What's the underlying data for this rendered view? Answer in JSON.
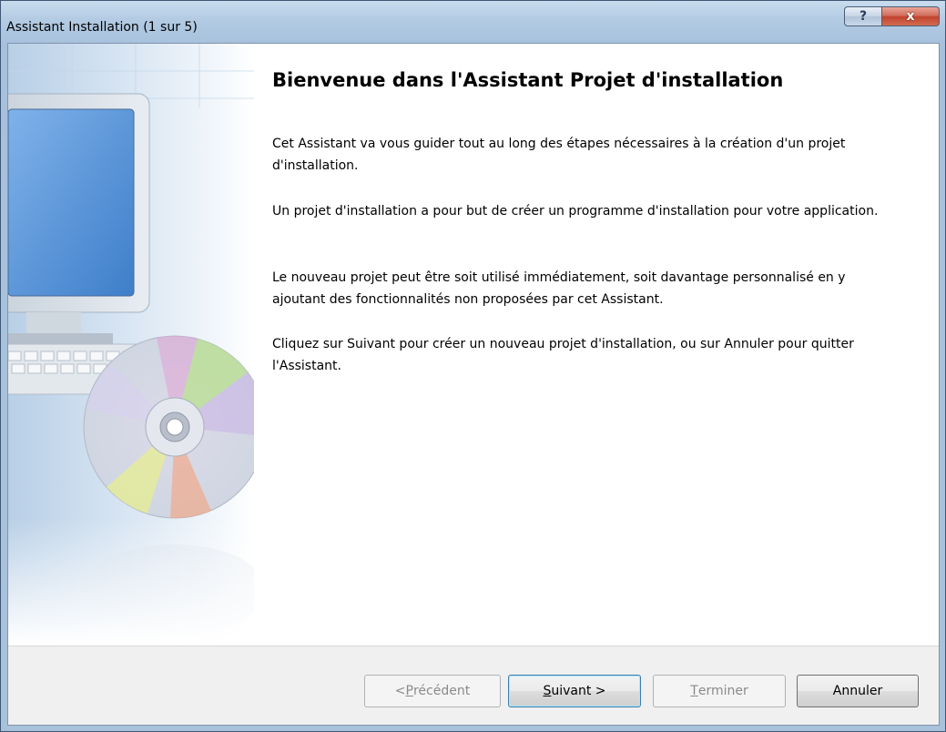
{
  "window": {
    "title": "Assistant Installation (1 sur 5)",
    "help_label": "?",
    "close_label": "x"
  },
  "content": {
    "heading": "Bienvenue dans l'Assistant Projet d'installation",
    "paragraphs": [
      "Cet Assistant va vous guider tout au long des étapes nécessaires à la création d'un projet d'installation.",
      "Un projet d'installation a pour but de créer un programme d'installation pour votre application.",
      "Le nouveau projet peut être soit utilisé immédiatement, soit davantage personnalisé en y ajoutant des fonctionnalités non proposées par cet Assistant.",
      "Cliquez sur Suivant pour créer un nouveau projet d'installation, ou sur Annuler pour quitter l'Assistant."
    ]
  },
  "buttons": {
    "previous": {
      "accel": "P",
      "rest": "récédent",
      "prefix": "< "
    },
    "next": {
      "accel": "S",
      "rest": "uivant >"
    },
    "finish": {
      "accel": "T",
      "rest": "erminer"
    },
    "cancel": {
      "label": "Annuler"
    }
  },
  "colors": {
    "title_bar": "#b3cbe3",
    "close_button": "#c2442e",
    "footer_bg": "#f0f0f0"
  }
}
